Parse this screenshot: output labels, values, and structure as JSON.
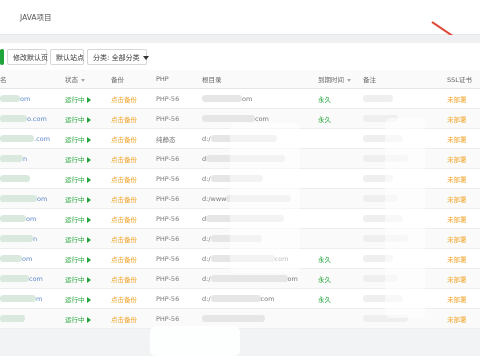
{
  "tabs": {
    "java_project": "JAVA项目"
  },
  "toolbar": {
    "default_page_label": "修改默认页",
    "default_site_label": "默认站点",
    "category_label": "分类: 全部分类"
  },
  "table": {
    "headers": [
      "名",
      "状态",
      "备份",
      "PHP",
      "根目录",
      "到期时间",
      "备注",
      "SSL证书"
    ],
    "rows": [
      {
        "name_suffix": "om",
        "status": "运行中",
        "backup": "点击备份",
        "php": "PHP-56",
        "root_prefix": "",
        "root_suffix": "om",
        "expiry": "永久",
        "note": "",
        "ssl": "未部署"
      },
      {
        "name_suffix": "o.com",
        "status": "运行中",
        "backup": "点击备份",
        "php": "PHP-56",
        "root_prefix": "",
        "root_suffix": "com",
        "expiry": "永久",
        "note": "",
        "ssl": "未部署"
      },
      {
        "name_suffix": ".com",
        "status": "运行中",
        "backup": "点击备份",
        "php": "纯静态",
        "root_prefix": "d:/",
        "root_suffix": "",
        "expiry": "",
        "note": "",
        "ssl": "未部署"
      },
      {
        "name_suffix": "n",
        "status": "运行中",
        "backup": "点击备份",
        "php": "PHP-56",
        "root_prefix": "d",
        "root_suffix": "",
        "expiry": "",
        "note": "",
        "ssl": "未部署"
      },
      {
        "name_suffix": "",
        "status": "运行中",
        "backup": "点击备份",
        "php": "PHP-56",
        "root_prefix": "d:/",
        "root_suffix": "",
        "expiry": "",
        "note": "",
        "ssl": "未部署"
      },
      {
        "name_suffix": "om",
        "status": "运行中",
        "backup": "点击备份",
        "php": "PHP-56",
        "root_prefix": "d:/www",
        "root_suffix": "",
        "expiry": "",
        "note": "",
        "ssl": "未部署"
      },
      {
        "name_suffix": "om",
        "status": "运行中",
        "backup": "点击备份",
        "php": "PHP-56",
        "root_prefix": "d",
        "root_suffix": "",
        "expiry": "",
        "note": "",
        "ssl": "未部署"
      },
      {
        "name_suffix": "n",
        "status": "运行中",
        "backup": "点击备份",
        "php": "PHP-56",
        "root_prefix": "d:/",
        "root_suffix": "",
        "expiry": "",
        "note": "",
        "ssl": "未部署"
      },
      {
        "name_suffix": "om",
        "status": "运行中",
        "backup": "点击备份",
        "php": "PHP-56",
        "root_prefix": "d:/",
        "root_suffix": "com",
        "expiry": "永久",
        "note": "",
        "ssl": "未部署"
      },
      {
        "name_suffix": "com",
        "status": "运行中",
        "backup": "点击备份",
        "php": "PHP-56",
        "root_prefix": "d:/",
        "root_suffix": "om",
        "expiry": "永久",
        "note": "",
        "ssl": "未部署"
      },
      {
        "name_suffix": "m",
        "status": "运行中",
        "backup": "点击备份",
        "php": "PHP-56",
        "root_prefix": "d:/",
        "root_suffix": "com",
        "expiry": "永久",
        "note": "",
        "ssl": "未部署"
      },
      {
        "name_suffix": "",
        "status": "运行中",
        "backup": "点击备份",
        "php": "PHP-56",
        "root_prefix": "",
        "root_suffix": "",
        "expiry": "",
        "note": "",
        "ssl": "未部署"
      }
    ]
  },
  "colors": {
    "accent": "#20a53a",
    "warning": "#f0a01f",
    "annotation": "#e04a3a"
  },
  "icons": {
    "status": "play-triangle-icon",
    "sort": "sort-down-icon",
    "dropdown": "chevron-down-icon"
  }
}
